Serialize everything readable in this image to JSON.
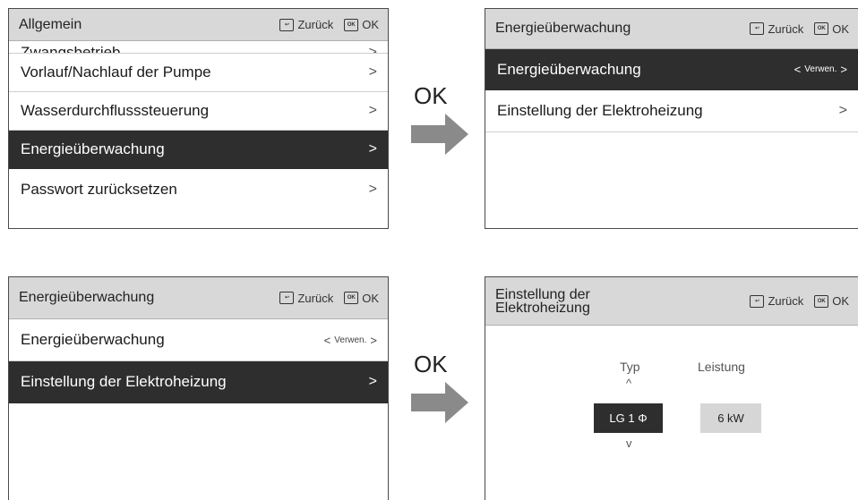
{
  "labels": {
    "back": "Zurück",
    "ok_icon": "OK",
    "ok": "OK",
    "arrow_right": ">",
    "chev_left": "<",
    "chev_right": ">",
    "caret_up": "^",
    "caret_down": "v"
  },
  "panel1": {
    "title": "Allgemein",
    "partial_item": "Zwangsbetrieb",
    "items": [
      {
        "label": "Vorlauf/Nachlauf der Pumpe"
      },
      {
        "label": "Wasserdurchflusssteuerung"
      },
      {
        "label": "Energieüberwachung"
      },
      {
        "label": "Passwort zurücksetzen"
      }
    ]
  },
  "panel2": {
    "title": "Energieüberwachung",
    "items": [
      {
        "label": "Energieüberwachung",
        "value": "Verwen."
      },
      {
        "label": "Einstellung der Elektroheizung"
      }
    ]
  },
  "panel3": {
    "title": "Energieüberwachung",
    "items": [
      {
        "label": "Energieüberwachung",
        "value": "Verwen."
      },
      {
        "label": "Einstellung der Elektroheizung"
      }
    ]
  },
  "panel4": {
    "title_line1": "Einstellung der",
    "title_line2": "Elektroheizung",
    "typ_label": "Typ",
    "typ_value": "LG 1 Φ",
    "leistung_label": "Leistung",
    "leistung_value": "6 kW"
  },
  "colors": {
    "header_bg": "#d8d8d8",
    "selected_bg": "#2e2e2e",
    "arrow": "#8a8a8a"
  }
}
